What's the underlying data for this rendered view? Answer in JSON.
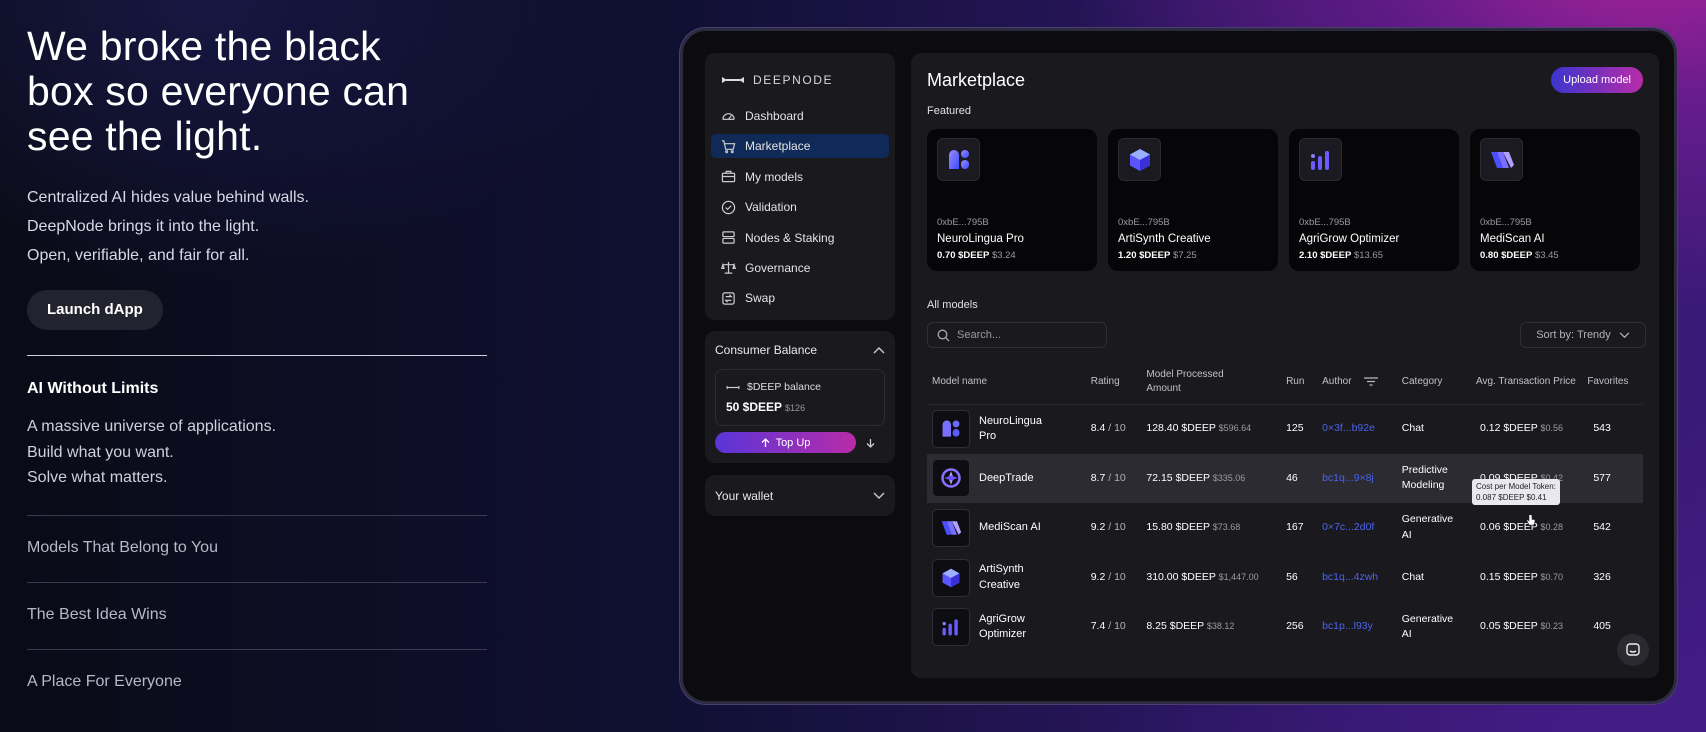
{
  "hero": {
    "title": "We broke the black box so everyone can see the light.",
    "lines": [
      "Centralized AI hides value behind walls.",
      "DeepNode brings it into the light.",
      "Open, verifiable, and fair for all."
    ],
    "cta": "Launch dApp"
  },
  "accordion": {
    "open_title": "AI Without Limits",
    "open_body": [
      "A massive universe of applications.",
      "Build what you want.",
      "Solve what matters."
    ],
    "items": [
      "Models That Belong to You",
      "The Best Idea Wins",
      "A Place For Everyone"
    ]
  },
  "app": {
    "logo": "DEEPNODE",
    "nav": [
      {
        "label": "Dashboard",
        "icon": "dashboard-icon"
      },
      {
        "label": "Marketplace",
        "icon": "cart-icon",
        "active": true
      },
      {
        "label": "My models",
        "icon": "briefcase-icon"
      },
      {
        "label": "Validation",
        "icon": "check-circle-icon"
      },
      {
        "label": "Nodes & Staking",
        "icon": "server-icon"
      },
      {
        "label": "Governance",
        "icon": "scale-icon"
      },
      {
        "label": "Swap",
        "icon": "swap-icon"
      }
    ],
    "balance": {
      "title": "Consumer Balance",
      "label": "$DEEP balance",
      "value": "50 $DEEP",
      "usd": "$126",
      "topup": "Top Up"
    },
    "wallet": "Your wallet",
    "main": {
      "title": "Marketplace",
      "upload": "Upload model",
      "featured_label": "Featured",
      "featured": [
        {
          "addr": "0xbE...795B",
          "name": "NeuroLingua Pro",
          "price": "0.70 $DEEP",
          "usd": "$3.24",
          "icon": "neurolingua-icon"
        },
        {
          "addr": "0xbE...795B",
          "name": "ArtiSynth Creative",
          "price": "1.20 $DEEP",
          "usd": "$7.25",
          "icon": "artisynth-icon"
        },
        {
          "addr": "0xbE...795B",
          "name": "AgriGrow Optimizer",
          "price": "2.10 $DEEP",
          "usd": "$13.65",
          "icon": "agrigrow-icon"
        },
        {
          "addr": "0xbE...795B",
          "name": "MediScan AI",
          "price": "0.80 $DEEP",
          "usd": "$3.45",
          "icon": "mediscan-icon"
        }
      ],
      "all_label": "All models",
      "search_placeholder": "Search...",
      "sort": "Sort by: Trendy",
      "columns": [
        "Model name",
        "Rating",
        "Model Processed Amount",
        "Run",
        "Author",
        "Category",
        "Avg. Transaction Price",
        "Favorites"
      ],
      "rows": [
        {
          "name": "NeuroLingua Pro",
          "rating": "8.4",
          "of": "/ 10",
          "amount": "128.40 $DEEP",
          "amount_usd": "$596.64",
          "run": "125",
          "author": "0×3f...b92e",
          "category": "Chat",
          "price": "0.12 $DEEP",
          "price_usd": "$0.56",
          "fav": "543",
          "icon": "neurolingua-icon"
        },
        {
          "name": "DeepTrade",
          "rating": "8.7",
          "of": "/ 10",
          "amount": "72.15 $DEEP",
          "amount_usd": "$335.06",
          "run": "46",
          "author": "bc1q...9×8j",
          "category": "Predictive Modeling",
          "price": "0.09 $DEEP",
          "price_usd": "$0.42",
          "fav": "577",
          "icon": "deeptrade-icon",
          "highlight": true
        },
        {
          "name": "MediScan AI",
          "rating": "9.2",
          "of": "/ 10",
          "amount": "15.80 $DEEP",
          "amount_usd": "$73.68",
          "run": "167",
          "author": "0×7c...2d0f",
          "category": "Generative AI",
          "price": "0.06 $DEEP",
          "price_usd": "$0.28",
          "fav": "542",
          "icon": "mediscan-icon"
        },
        {
          "name": "ArtiSynth Creative",
          "rating": "9.2",
          "of": "/ 10",
          "amount": "310.00 $DEEP",
          "amount_usd": "$1,447.00",
          "run": "56",
          "author": "bc1q...4zwh",
          "category": "Chat",
          "price": "0.15 $DEEP",
          "price_usd": "$0.70",
          "fav": "326",
          "icon": "artisynth-icon"
        },
        {
          "name": "AgriGrow Optimizer",
          "rating": "7.4",
          "of": "/ 10",
          "amount": "8.25 $DEEP",
          "amount_usd": "$38.12",
          "run": "256",
          "author": "bc1p...l93y",
          "category": "Generative AI",
          "price": "0.05 $DEEP",
          "price_usd": "$0.23",
          "fav": "405",
          "icon": "agrigrow-icon"
        }
      ],
      "tooltip": [
        "Cost per Model Token:",
        "0.087 $DEEP $0.41"
      ]
    }
  }
}
